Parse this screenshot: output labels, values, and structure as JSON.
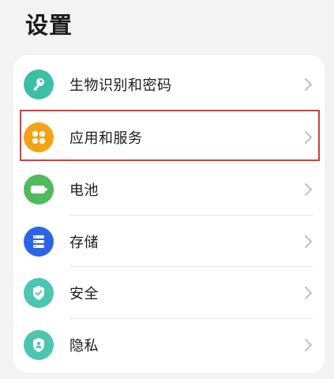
{
  "header": {
    "title": "设置"
  },
  "settings": {
    "items": [
      {
        "label": "生物识别和密码",
        "icon": "key-icon",
        "color": "#3dbfa6"
      },
      {
        "label": "应用和服务",
        "icon": "apps-grid-icon",
        "color": "#f5a316"
      },
      {
        "label": "电池",
        "icon": "battery-icon",
        "color": "#4fbb5c"
      },
      {
        "label": "存储",
        "icon": "storage-icon",
        "color": "#2d63e6"
      },
      {
        "label": "安全",
        "icon": "shield-check-icon",
        "color": "#4cc6b0"
      },
      {
        "label": "隐私",
        "icon": "privacy-shield-icon",
        "color": "#4cc6b0"
      }
    ],
    "chevron_icon": "chevron-right-icon"
  },
  "highlight": {
    "target": "应用和服务",
    "color": "#d93a3a"
  }
}
